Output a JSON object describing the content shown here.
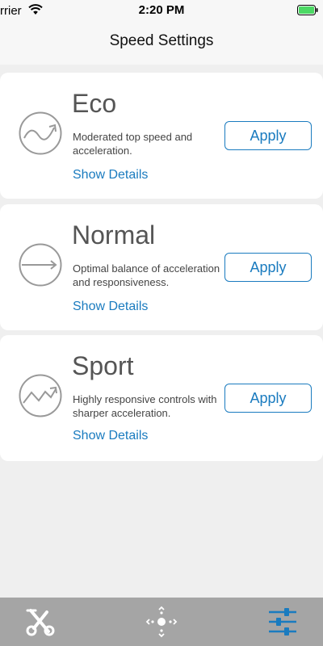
{
  "status_bar": {
    "carrier": "rrier",
    "time": "2:20 PM",
    "battery_color": "#4cd964"
  },
  "nav": {
    "title": "Speed Settings"
  },
  "modes": [
    {
      "title": "Eco",
      "description": "Moderated top speed and acceleration.",
      "details_link": "Show Details",
      "apply_label": "Apply",
      "icon": "wave-curve-icon"
    },
    {
      "title": "Normal",
      "description": "Optimal balance of acceleration and responsiveness.",
      "details_link": "Show Details",
      "apply_label": "Apply",
      "icon": "straight-arrow-icon"
    },
    {
      "title": "Sport",
      "description": "Highly responsive controls with sharper acceleration.",
      "details_link": "Show Details",
      "apply_label": "Apply",
      "icon": "zigzag-arrow-icon"
    }
  ],
  "tab_bar": {
    "tabs": [
      {
        "icon": "scooter-icon",
        "active": false
      },
      {
        "icon": "move-directions-icon",
        "active": false
      },
      {
        "icon": "sliders-icon",
        "active": true
      }
    ],
    "active_color": "#1a7bbf",
    "inactive_color": "#ffffff"
  },
  "colors": {
    "accent": "#1a7bbf",
    "background": "#efefef",
    "card": "#ffffff"
  }
}
